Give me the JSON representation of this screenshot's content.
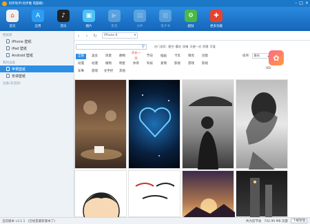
{
  "title_bar": {
    "title": "同步助手(同步推 电脑端)"
  },
  "toolbar": {
    "items": [
      {
        "label": "首页",
        "icon": "home-icon",
        "color": "#f0f0f0"
      },
      {
        "label": "应用",
        "icon": "app-store-icon",
        "color": "#2a9df4"
      },
      {
        "label": "音乐",
        "icon": "music-icon",
        "color": "#222222"
      },
      {
        "label": "图片",
        "icon": "picture-icon",
        "color": "#4dc1f5"
      },
      {
        "label": "影音",
        "icon": "video-icon",
        "color": "#8ec6e8"
      },
      {
        "label": "文件",
        "icon": "folder-icon",
        "color": "#8ec6e8"
      },
      {
        "label": "电子书",
        "icon": "book-icon",
        "color": "#8ec6e8"
      },
      {
        "label": "越狱",
        "icon": "jailbreak-icon",
        "color": "#4cb848"
      },
      {
        "label": "更多功能",
        "icon": "more-icon",
        "color": "#e8432d"
      }
    ]
  },
  "sidebar": {
    "section1": "壁纸库",
    "items1": [
      "iPhone 壁纸",
      "iPad 壁纸",
      "Android 壁纸"
    ],
    "section2": "我的设备",
    "items2": [
      "苹果壁纸",
      "安卓壁纸"
    ],
    "section3": "设备(未连接)"
  },
  "nav": {
    "device": "iPhone 6"
  },
  "hot": {
    "label": "热门搜索:",
    "terms": [
      "星空",
      "樱花",
      "玫瑰",
      "天使一对",
      "阿狸",
      "可爱"
    ]
  },
  "categories": {
    "row1": [
      "全部",
      "美女",
      "风景",
      "静物",
      "天长一对",
      "节日",
      "插画",
      "卡车",
      "萌亮",
      "创意"
    ],
    "row2": [
      "动漫",
      "动漫",
      "植物",
      "明星",
      "体育",
      "科技",
      "爱情",
      "影视",
      "游戏",
      "影视"
    ],
    "row3": [
      "军事",
      "游戏",
      "文字控",
      "其他"
    ]
  },
  "sort": {
    "label": "排序:",
    "value": "最热"
  },
  "hd": {
    "label": "HD"
  },
  "status": {
    "version": "当前版本 v3.1.1",
    "update": "(已经是最新版本了)",
    "speed": "共为您节省",
    "size": "742.99 MB 流量",
    "download": "下载管理"
  },
  "colors": {
    "titlebar": "#1b78c8",
    "toolbar": "#1b72c8",
    "selected": "#2d8ee6"
  }
}
